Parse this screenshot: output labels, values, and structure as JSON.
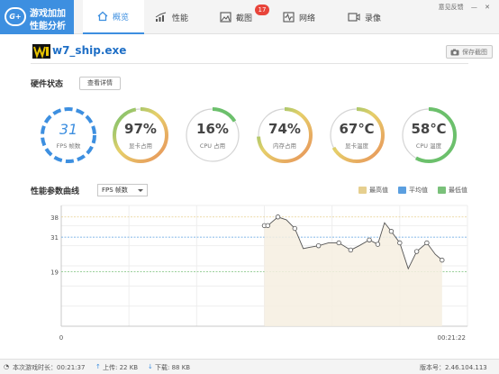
{
  "app": {
    "logo_badge": "G+",
    "name_line1": "游戏加加",
    "name_line2": "性能分析",
    "feedback": "意见反馈"
  },
  "tabs": [
    {
      "label": "概览",
      "icon": "home-icon",
      "active": true
    },
    {
      "label": "性能",
      "icon": "bar-chart-icon",
      "active": false
    },
    {
      "label": "截图",
      "icon": "image-icon",
      "active": false,
      "badge": "17"
    },
    {
      "label": "网络",
      "icon": "pulse-icon",
      "active": false
    },
    {
      "label": "录像",
      "icon": "video-icon",
      "active": false
    }
  ],
  "game": {
    "title": "w7_ship.exe",
    "screenshot_button": "保存截图"
  },
  "hardware": {
    "title": "硬件状态",
    "detail_button": "查看详情",
    "gauges": [
      {
        "value": "31",
        "label": "FPS 帧数",
        "fraction": 1.0,
        "kind": "fps"
      },
      {
        "value": "97%",
        "label": "显卡占用",
        "fraction": 0.97,
        "kind": "gradient"
      },
      {
        "value": "16%",
        "label": "CPU 占用",
        "fraction": 0.16,
        "kind": "green"
      },
      {
        "value": "74%",
        "label": "内存占用",
        "fraction": 0.74,
        "kind": "gradient"
      },
      {
        "value": "67℃",
        "label": "显卡温度",
        "fraction": 0.67,
        "kind": "gradient"
      },
      {
        "value": "58℃",
        "label": "CPU 温度",
        "fraction": 0.58,
        "kind": "green"
      }
    ]
  },
  "curve": {
    "title": "性能参数曲线",
    "select_value": "FPS 帧数",
    "legend": [
      {
        "label": "最高值",
        "color": "#e6cf8f"
      },
      {
        "label": "平均值",
        "color": "#5b9fe0"
      },
      {
        "label": "最低值",
        "color": "#7ac17a"
      }
    ]
  },
  "chart_data": {
    "type": "line",
    "yticks": [
      19,
      31,
      38
    ],
    "max_line": 38,
    "avg_line": 31,
    "min_line": 19,
    "ylim": [
      0,
      42
    ],
    "x_start_label": "0",
    "x_end_label": "00:21:22",
    "series": [
      {
        "x": [
          0.6,
          0.61,
          0.64,
          0.665,
          0.69,
          0.715,
          0.735,
          0.76,
          0.79,
          0.82,
          0.855,
          0.88,
          0.91,
          0.935,
          0.955,
          0.975,
          1.0,
          1.025,
          1.05,
          1.08,
          1.105,
          1.125
        ],
        "values": [
          35,
          35,
          38,
          37,
          34,
          27,
          27.5,
          28,
          29,
          29,
          26.5,
          28,
          30,
          28.5,
          36,
          33,
          29,
          20,
          26,
          29,
          25,
          23
        ]
      }
    ]
  },
  "footer": {
    "game_time": "本次游戏时长：00:21:37",
    "upload": "上传: 22 KB",
    "download": "下载: 88 KB",
    "version": "版本号：2.46.104.113"
  }
}
